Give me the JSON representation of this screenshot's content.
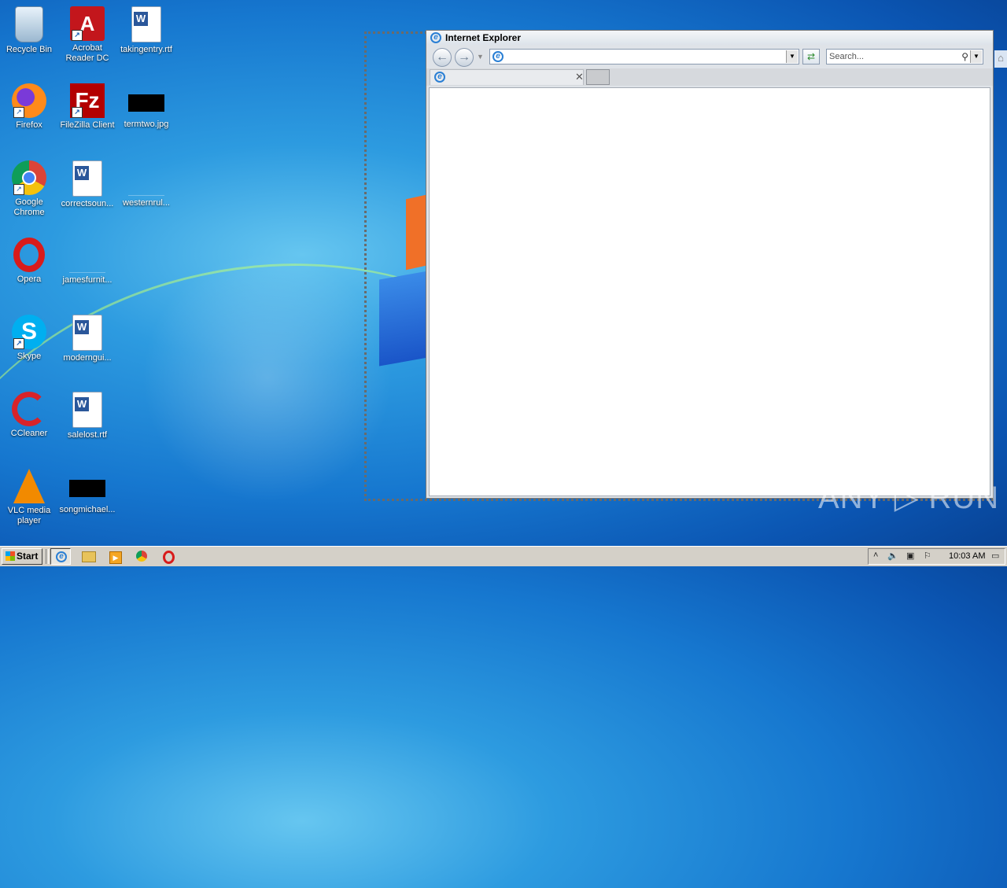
{
  "desktop": {
    "icons": [
      {
        "label": "Recycle Bin"
      },
      {
        "label": "Acrobat Reader DC"
      },
      {
        "label": "takingentry.rtf"
      },
      {
        "label": "Firefox"
      },
      {
        "label": "FileZilla Client"
      },
      {
        "label": "termtwo.jpg"
      },
      {
        "label": "Google Chrome"
      },
      {
        "label": "correctsoun..."
      },
      {
        "label": "westernrul..."
      },
      {
        "label": "Opera"
      },
      {
        "label": "jamesfurnit..."
      },
      {
        "label": "Skype"
      },
      {
        "label": "moderngui..."
      },
      {
        "label": "CCleaner"
      },
      {
        "label": "salelost.rtf"
      },
      {
        "label": "VLC media player"
      },
      {
        "label": "songmichael..."
      }
    ],
    "watermark": "ANY ▷ RUN"
  },
  "ie": {
    "title": "Internet Explorer",
    "address_value": "",
    "search_placeholder": "Search...",
    "tab_title": ""
  },
  "taskbar": {
    "start_label": "Start",
    "items": [
      "internet-explorer-icon",
      "explorer-icon",
      "media-player-icon",
      "chrome-icon",
      "opera-icon"
    ],
    "clock": "10:03 AM"
  }
}
